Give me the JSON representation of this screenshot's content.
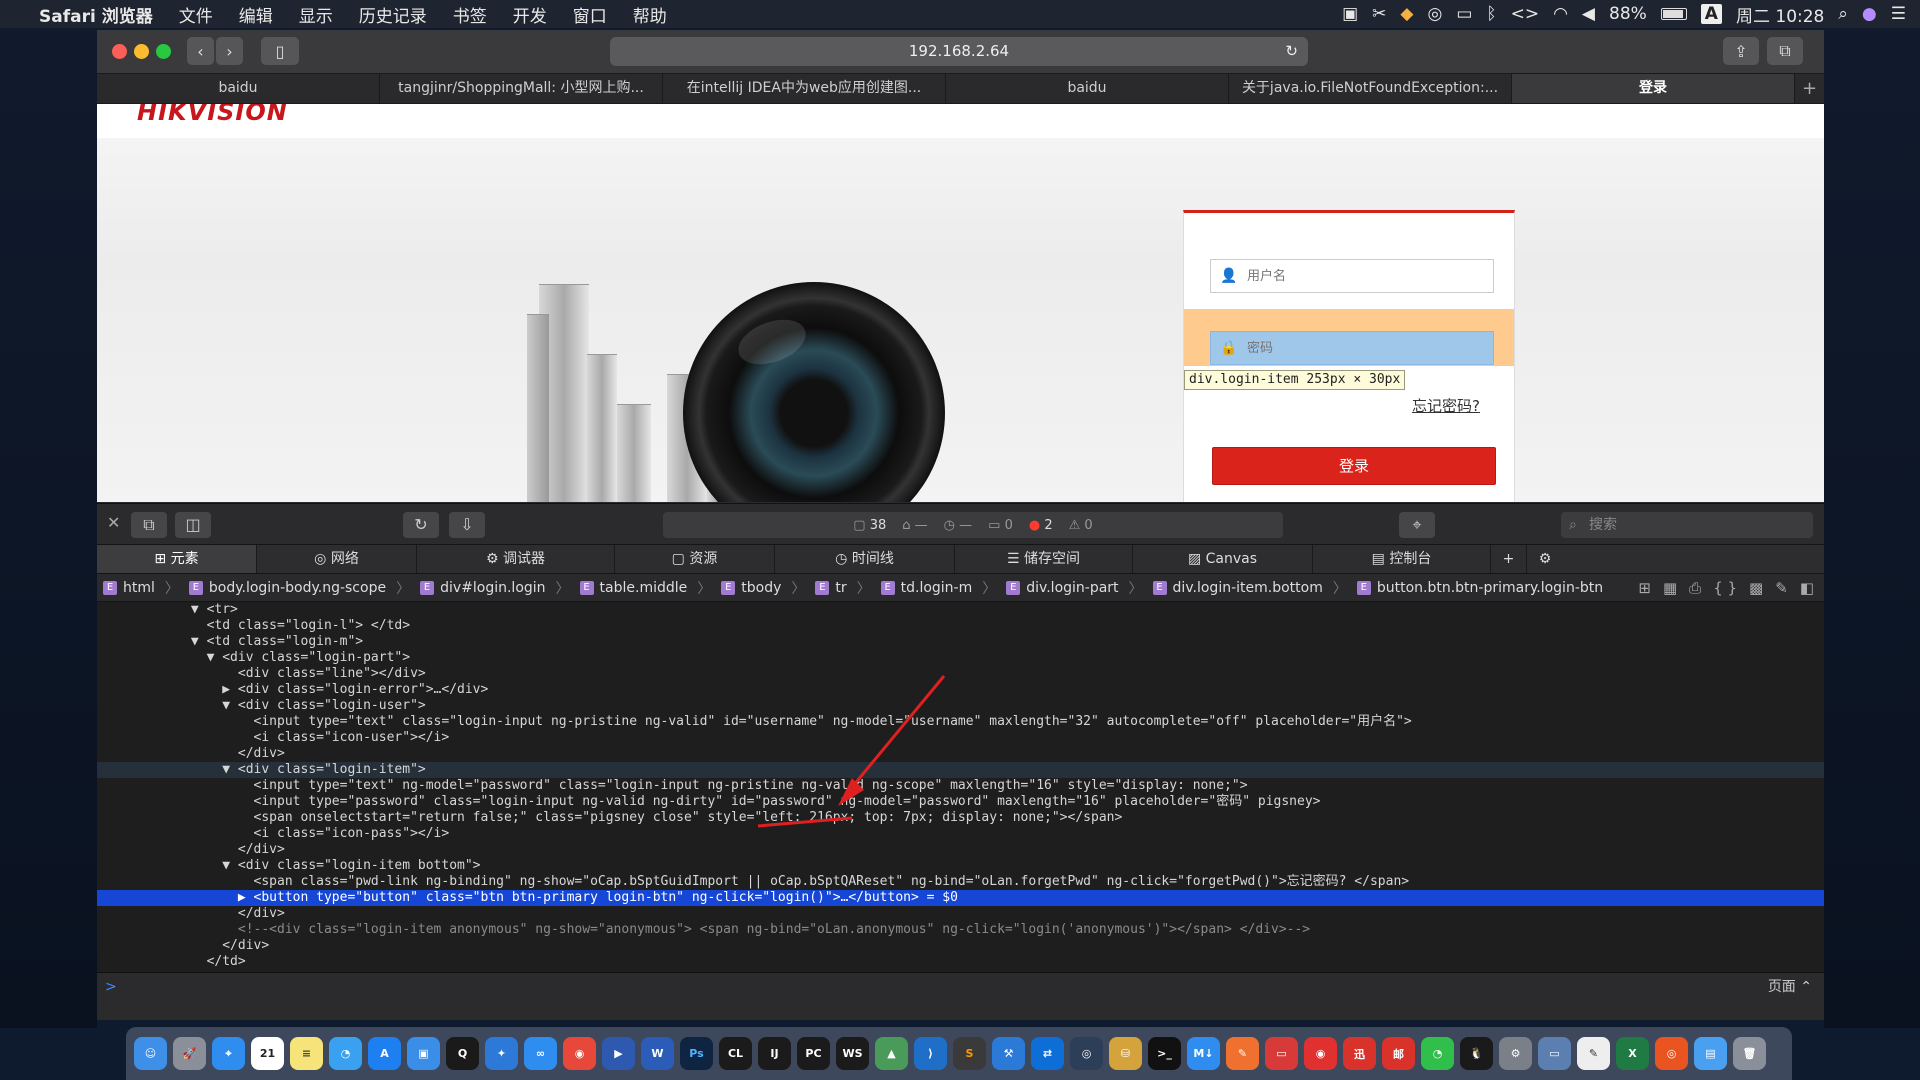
{
  "menubar": {
    "apple": "",
    "app": "Safari 浏览器",
    "items": [
      "文件",
      "编辑",
      "显示",
      "历史记录",
      "书签",
      "开发",
      "窗口",
      "帮助"
    ],
    "battery": "88%",
    "input_method": "A",
    "clock": "周二 10:28"
  },
  "browser": {
    "url": "192.168.2.64",
    "tabs": [
      {
        "label": "baidu"
      },
      {
        "label": "tangjinr/ShoppingMall: 小型网上购..."
      },
      {
        "label": "在intellij IDEA中为web应用创建图..."
      },
      {
        "label": "baidu"
      },
      {
        "label": "关于java.io.FileNotFoundException:..."
      },
      {
        "label": "登录",
        "active": true
      }
    ],
    "new_tab": "+"
  },
  "page": {
    "logo": "HIKVISION",
    "username_placeholder": "用户名",
    "password_placeholder": "密码",
    "tooltip": "div.login-item 253px × 30px",
    "forgot": "忘记密码?",
    "login_button": "登录"
  },
  "inspector": {
    "resource_count": "38",
    "dash1": "—",
    "dash2": "—",
    "log_count": "0",
    "error_count": "2",
    "warning_count": "0",
    "search_placeholder": "搜索",
    "tabs": [
      {
        "label": "元素",
        "icon": "elements-icon",
        "active": true
      },
      {
        "label": "网络",
        "icon": "network-icon"
      },
      {
        "label": "调试器",
        "icon": "debugger-icon"
      },
      {
        "label": "资源",
        "icon": "resources-icon"
      },
      {
        "label": "时间线",
        "icon": "timeline-icon"
      },
      {
        "label": "储存空间",
        "icon": "storage-icon"
      },
      {
        "label": "Canvas",
        "icon": "canvas-icon"
      },
      {
        "label": "控制台",
        "icon": "console-icon"
      }
    ],
    "breadcrumbs": [
      "html",
      "body.login-body.ng-scope",
      "div#login.login",
      "table.middle",
      "tbody",
      "tr",
      "td.login-m",
      "div.login-part",
      "div.login-item.bottom",
      "button.btn.btn-primary.login-btn"
    ],
    "dom_lines": [
      "            ▼ <tr>",
      "              <td class=\"login-l\"> </td>",
      "            ▼ <td class=\"login-m\">",
      "              ▼ <div class=\"login-part\">",
      "                  <div class=\"line\"></div>",
      "                ▶ <div class=\"login-error\">…</div>",
      "                ▼ <div class=\"login-user\">",
      "                    <input type=\"text\" class=\"login-input ng-pristine ng-valid\" id=\"username\" ng-model=\"username\" maxlength=\"32\" autocomplete=\"off\" placeholder=\"用户名\">",
      "                    <i class=\"icon-user\"></i>",
      "                  </div>",
      "                ▼ <div class=\"login-item\">",
      "                    <input type=\"text\" ng-model=\"password\" class=\"login-input ng-pristine ng-valid ng-scope\" maxlength=\"16\" style=\"display: none;\">",
      "                    <input type=\"password\" class=\"login-input ng-valid ng-dirty\" id=\"password\" ng-model=\"password\" maxlength=\"16\" placeholder=\"密码\" pigsney>",
      "                    <span onselectstart=\"return false;\" class=\"pigsney close\" style=\"left: 216px; top: 7px; display: none;\"></span>",
      "                    <i class=\"icon-pass\"></i>",
      "                  </div>",
      "                ▼ <div class=\"login-item bottom\">",
      "                    <span class=\"pwd-link ng-binding\" ng-show=\"oCap.bSptGuidImport || oCap.bSptQAReset\" ng-bind=\"oLan.forgetPwd\" ng-click=\"forgetPwd()\">忘记密码? </span>",
      "                  ▶ <button type=\"button\" class=\"btn btn-primary login-btn\" ng-click=\"login()\">…</button> = $0",
      "                  </div>",
      "                  <!--<div class=\"login-item anonymous\" ng-show=\"anonymous\"> <span ng-bind=\"oLan.anonymous\" ng-click=\"login('anonymous')\"></span> </div>-->",
      "                </div>",
      "              </td>"
    ],
    "console_prompt": ">",
    "console_context": "页面 ⌃"
  },
  "colors": {
    "selected_line": "#1546d6",
    "login_red": "#d9231b",
    "annotation_arrow": "#e02020"
  }
}
